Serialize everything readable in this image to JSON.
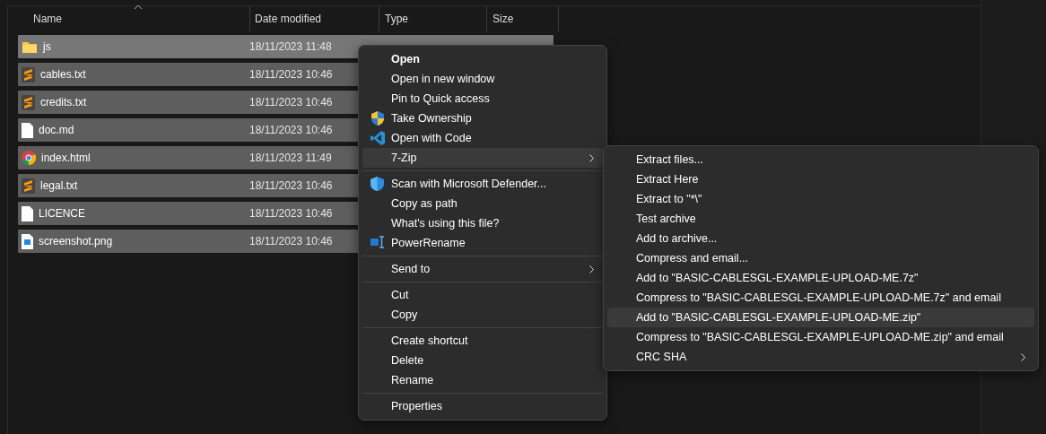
{
  "columns": [
    {
      "label": "Name",
      "sorted": true
    },
    {
      "label": "Date modified",
      "sorted": false
    },
    {
      "label": "Type",
      "sorted": false
    },
    {
      "label": "Size",
      "sorted": false
    }
  ],
  "files": [
    {
      "kind": "folder",
      "name": "js",
      "date": "18/11/2023 11:48",
      "selected": true,
      "hovered": true
    },
    {
      "kind": "sublime",
      "name": "cables.txt",
      "date": "18/11/2023 10:46",
      "selected": true,
      "hovered": false
    },
    {
      "kind": "sublime",
      "name": "credits.txt",
      "date": "18/11/2023 10:46",
      "selected": true,
      "hovered": false
    },
    {
      "kind": "blank",
      "name": "doc.md",
      "date": "18/11/2023 10:46",
      "selected": true,
      "hovered": false
    },
    {
      "kind": "browser",
      "name": "index.html",
      "date": "18/11/2023 11:49",
      "selected": true,
      "hovered": false
    },
    {
      "kind": "sublime",
      "name": "legal.txt",
      "date": "18/11/2023 10:46",
      "selected": true,
      "hovered": false
    },
    {
      "kind": "blank",
      "name": "LICENCE",
      "date": "18/11/2023 10:46",
      "selected": true,
      "hovered": false
    },
    {
      "kind": "image",
      "name": "screenshot.png",
      "date": "18/11/2023 10:46",
      "selected": true,
      "hovered": false
    }
  ],
  "context_menu": {
    "items": [
      {
        "kind": "item",
        "label": "Open",
        "bold": true,
        "selected": false,
        "submenu": false
      },
      {
        "kind": "item",
        "label": "Open in new window",
        "bold": false,
        "selected": false,
        "submenu": false
      },
      {
        "kind": "item",
        "label": "Pin to Quick access",
        "bold": false,
        "selected": false,
        "submenu": false
      },
      {
        "kind": "item",
        "label": "Take Ownership",
        "bold": false,
        "selected": false,
        "submenu": false
      },
      {
        "kind": "item",
        "label": "Open with Code",
        "bold": false,
        "selected": false,
        "submenu": false
      },
      {
        "kind": "item",
        "label": "7-Zip",
        "bold": false,
        "selected": true,
        "submenu": true
      },
      {
        "kind": "separator"
      },
      {
        "kind": "item",
        "label": "Scan with Microsoft Defender...",
        "bold": false,
        "selected": false,
        "submenu": false
      },
      {
        "kind": "item",
        "label": "Copy as path",
        "bold": false,
        "selected": false,
        "submenu": false
      },
      {
        "kind": "item",
        "label": "What's using this file?",
        "bold": false,
        "selected": false,
        "submenu": false
      },
      {
        "kind": "item",
        "label": "PowerRename",
        "bold": false,
        "selected": false,
        "submenu": false
      },
      {
        "kind": "separator"
      },
      {
        "kind": "item",
        "label": "Send to",
        "bold": false,
        "selected": false,
        "submenu": true
      },
      {
        "kind": "separator"
      },
      {
        "kind": "item",
        "label": "Cut",
        "bold": false,
        "selected": false,
        "submenu": false
      },
      {
        "kind": "item",
        "label": "Copy",
        "bold": false,
        "selected": false,
        "submenu": false
      },
      {
        "kind": "separator"
      },
      {
        "kind": "item",
        "label": "Create shortcut",
        "bold": false,
        "selected": false,
        "submenu": false
      },
      {
        "kind": "item",
        "label": "Delete",
        "bold": false,
        "selected": false,
        "submenu": false
      },
      {
        "kind": "item",
        "label": "Rename",
        "bold": false,
        "selected": false,
        "submenu": false
      },
      {
        "kind": "separator"
      },
      {
        "kind": "item",
        "label": "Properties",
        "bold": false,
        "selected": false,
        "submenu": false
      }
    ]
  },
  "submenu": {
    "items": [
      {
        "kind": "item",
        "label": "Extract files...",
        "bold": false,
        "selected": false,
        "submenu": false
      },
      {
        "kind": "item",
        "label": "Extract Here",
        "bold": false,
        "selected": false,
        "submenu": false
      },
      {
        "kind": "item",
        "label": "Extract to \"*\\\"",
        "bold": false,
        "selected": false,
        "submenu": false
      },
      {
        "kind": "item",
        "label": "Test archive",
        "bold": false,
        "selected": false,
        "submenu": false
      },
      {
        "kind": "item",
        "label": "Add to archive...",
        "bold": false,
        "selected": false,
        "submenu": false
      },
      {
        "kind": "item",
        "label": "Compress and email...",
        "bold": false,
        "selected": false,
        "submenu": false
      },
      {
        "kind": "item",
        "label": "Add to \"BASIC-CABLESGL-EXAMPLE-UPLOAD-ME.7z\"",
        "bold": false,
        "selected": false,
        "submenu": false
      },
      {
        "kind": "item",
        "label": "Compress to \"BASIC-CABLESGL-EXAMPLE-UPLOAD-ME.7z\" and email",
        "bold": false,
        "selected": false,
        "submenu": false
      },
      {
        "kind": "item",
        "label": "Add to \"BASIC-CABLESGL-EXAMPLE-UPLOAD-ME.zip\"",
        "bold": false,
        "selected": true,
        "submenu": false
      },
      {
        "kind": "item",
        "label": "Compress to \"BASIC-CABLESGL-EXAMPLE-UPLOAD-ME.zip\" and email",
        "bold": false,
        "selected": false,
        "submenu": false
      },
      {
        "kind": "item",
        "label": "CRC SHA",
        "bold": false,
        "selected": false,
        "submenu": true
      }
    ]
  }
}
